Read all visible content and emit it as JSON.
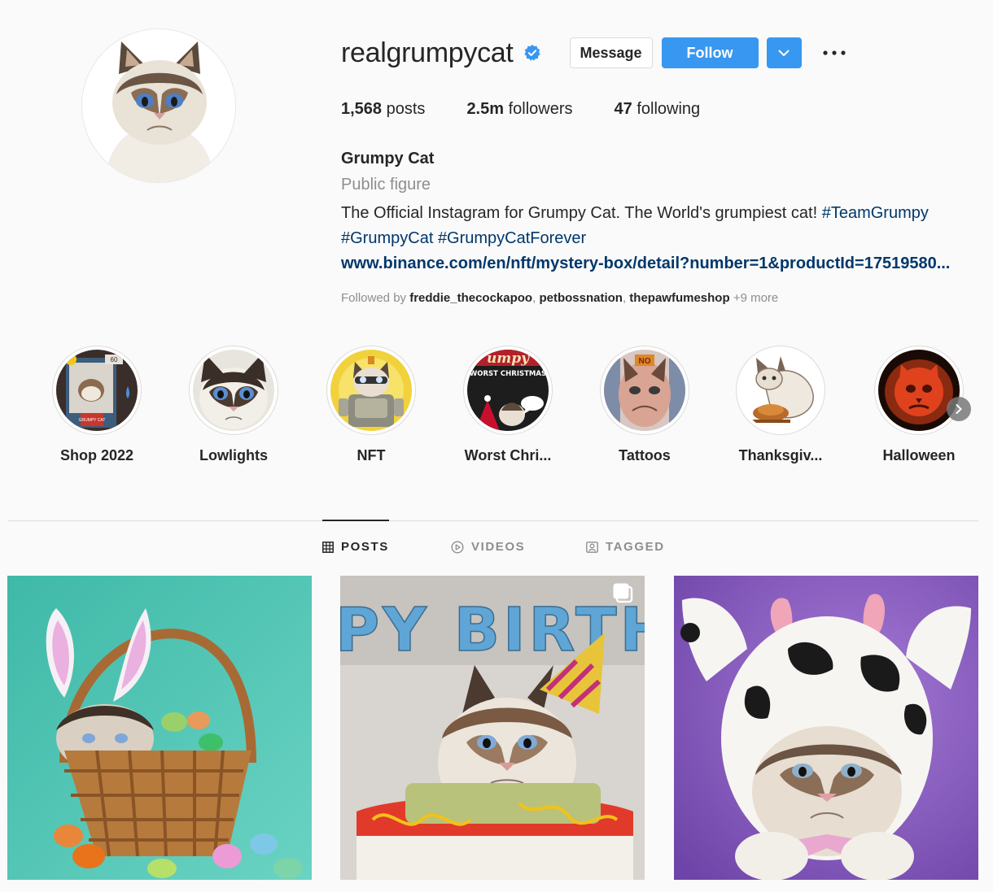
{
  "profile": {
    "username": "realgrumpycat",
    "verified": true,
    "message_label": "Message",
    "follow_label": "Follow",
    "stats": {
      "posts_count": "1,568",
      "posts_label": "posts",
      "followers_count": "2.5m",
      "followers_label": "followers",
      "following_count": "47",
      "following_label": "following"
    },
    "full_name": "Grumpy Cat",
    "category": "Public figure",
    "bio_text": "The Official Instagram for Grumpy Cat. The World's grumpiest cat!",
    "bio_hashtag_1": "#TeamGrumpy",
    "bio_hashtag_2": "#GrumpyCat",
    "bio_hashtag_3": "#GrumpyCatForever",
    "link": "www.binance.com/en/nft/mystery-box/detail?number=1&productId=17519580...",
    "followed_by_prefix": "Followed by",
    "followed_by_1": "freddie_thecockapoo",
    "followed_by_2": "petbossnation",
    "followed_by_3": "thepawfumeshop",
    "followed_by_more": "+9 more"
  },
  "highlights": [
    {
      "label": "Shop 2022"
    },
    {
      "label": "Lowlights"
    },
    {
      "label": "NFT"
    },
    {
      "label": "Worst Chri..."
    },
    {
      "label": "Tattoos"
    },
    {
      "label": "Thanksgiv..."
    },
    {
      "label": "Halloween"
    }
  ],
  "highlight_art": {
    "worst_christmas_title": "umpy",
    "worst_christmas_sub": "WORST CHRISTMAS",
    "tattoo_badge": "NO",
    "shop_badge": "60",
    "shop_box_label": "GRUMPY CAT"
  },
  "tabs": [
    {
      "label": "POSTS",
      "active": true
    },
    {
      "label": "VIDEOS",
      "active": false
    },
    {
      "label": "TAGGED",
      "active": false
    }
  ],
  "posts": {
    "birthday_banner": "PY BIRTHD"
  },
  "colors": {
    "accent": "#3897f0",
    "link": "#00376b",
    "secondary_text": "#8e8e8e"
  }
}
